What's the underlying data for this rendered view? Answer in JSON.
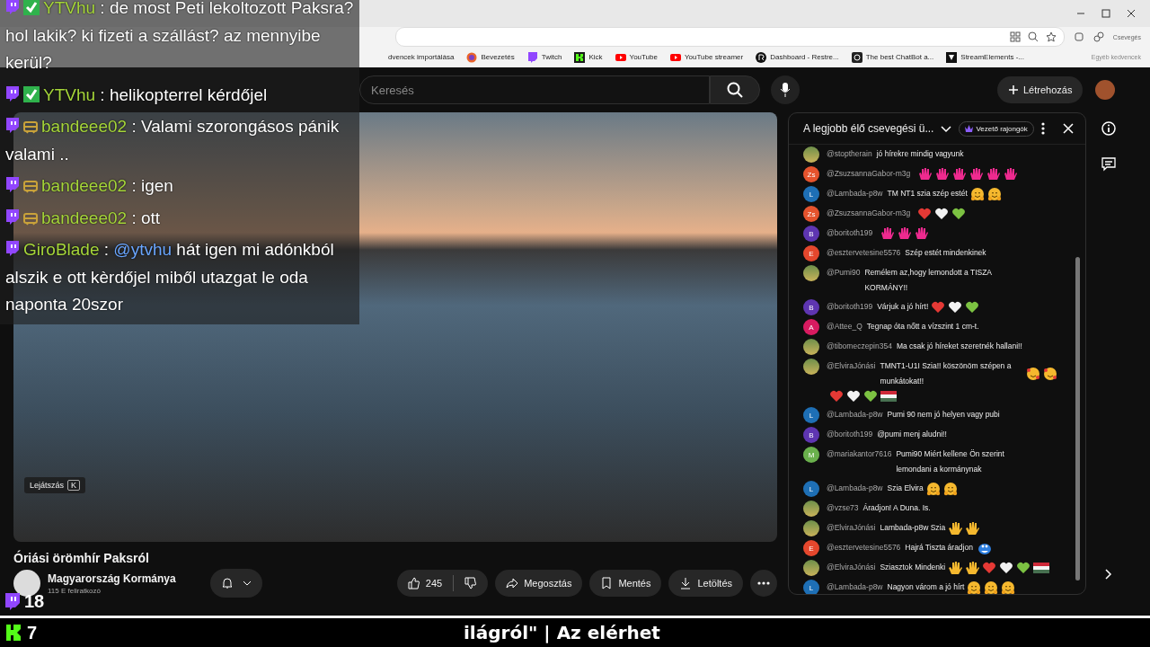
{
  "browser": {
    "bookmarks": [
      {
        "label": "dvencek importálása",
        "kind": "import"
      },
      {
        "label": "Bevezetés",
        "kind": "firefox"
      },
      {
        "label": "Twitch",
        "kind": "twitch"
      },
      {
        "label": "Kick",
        "kind": "kick"
      },
      {
        "label": "YouTube",
        "kind": "youtube"
      },
      {
        "label": "YouTube streamer",
        "kind": "youtube"
      },
      {
        "label": "Dashboard - Restre...",
        "kind": "restream"
      },
      {
        "label": "The best ChatBot a...",
        "kind": "chatbot"
      },
      {
        "label": "StreamElements -...",
        "kind": "streamelements"
      }
    ],
    "side_label": "Csevegés",
    "other_bookmarks": "Egyéb kedvencek"
  },
  "youtube": {
    "search": {
      "placeholder": "Keresés"
    },
    "create_label": "Létrehozás"
  },
  "video": {
    "tooltip": "Lejátszás",
    "shortcut": "K",
    "title": "Óriási örömhír Paksról",
    "channel": "Magyarország Kormánya",
    "subscribers": "115 E feliratkozó",
    "likes": "245",
    "actions": [
      {
        "label": "Megosztás",
        "kind": "share"
      },
      {
        "label": "Mentés",
        "kind": "save"
      },
      {
        "label": "Letöltés",
        "kind": "download"
      }
    ]
  },
  "chat": {
    "title": "A legjobb élő csevegési ü...",
    "filter": "Vezető rajongók",
    "messages": [
      {
        "kind": "photo",
        "author": "@stoptherain",
        "text": "jó hírekre mindig vagyunk"
      },
      {
        "kind": "letter",
        "letter": "Zs",
        "color": "#e5532d",
        "author": "@ZsuzsannaGabor-m3g",
        "emojis": [
          {
            "kind": "hand"
          },
          {
            "kind": "hand"
          },
          {
            "kind": "hand"
          },
          {
            "kind": "hand"
          },
          {
            "kind": "hand"
          },
          {
            "kind": "hand"
          }
        ]
      },
      {
        "kind": "letter",
        "letter": "L",
        "color": "#1e6fb5",
        "author": "@Lambada-p8w",
        "text": "TM NT1 szia szép estét",
        "emojis": [
          {
            "kind": "hug"
          },
          {
            "kind": "hug"
          }
        ]
      },
      {
        "kind": "letter",
        "letter": "Zs",
        "color": "#e5532d",
        "author": "@ZsuzsannaGabor-m3g",
        "emojis": [
          {
            "kind": "heart_red"
          },
          {
            "kind": "heart_white"
          },
          {
            "kind": "heart_green"
          }
        ]
      },
      {
        "kind": "letter",
        "letter": "B",
        "color": "#5e35b1",
        "author": "@boritoth199",
        "emojis": [
          {
            "kind": "hand"
          },
          {
            "kind": "hand"
          },
          {
            "kind": "hand"
          }
        ]
      },
      {
        "kind": "letter",
        "letter": "E",
        "color": "#e5472d",
        "author": "@esztervetesine5576",
        "text": "Szép estét mindenkinek"
      },
      {
        "kind": "photo",
        "author": "@Pumi90",
        "text": "Remélem az,hogy lemondott a TISZA KORMÁNY!!"
      },
      {
        "kind": "letter",
        "letter": "B",
        "color": "#5e35b1",
        "author": "@boritoth199",
        "text": "Várjuk a jó hírt!",
        "emojis": [
          {
            "kind": "heart_red"
          },
          {
            "kind": "heart_white"
          },
          {
            "kind": "heart_green"
          }
        ]
      },
      {
        "kind": "letter",
        "letter": "A",
        "color": "#d81b60",
        "author": "@Attee_Q",
        "text": "Tegnap óta nőtt a vízszint 1 cm-t."
      },
      {
        "kind": "photo",
        "author": "@tibomeczepin354",
        "text": "Ma csak jó híreket szeretnék hallani!!"
      },
      {
        "kind": "photo",
        "author": "@ElviraJónási",
        "text": "TMNT1-U1I Szia!! köszönöm szépen a munkátokat!!",
        "emojis": [
          {
            "kind": "love"
          },
          {
            "kind": "love"
          },
          {
            "kind": "heart_red"
          },
          {
            "kind": "heart_white"
          },
          {
            "kind": "heart_green"
          },
          {
            "kind": "flag_hu"
          }
        ]
      },
      {
        "kind": "letter",
        "letter": "L",
        "color": "#1e6fb5",
        "author": "@Lambada-p8w",
        "text": "Pumi 90 nem jó helyen vagy pubi"
      },
      {
        "kind": "letter",
        "letter": "B",
        "color": "#5e35b1",
        "author": "@boritoth199",
        "text": "@pumi menj aludni!!"
      },
      {
        "kind": "letter",
        "letter": "M",
        "color": "#6ab04c",
        "author": "@mariakantor7616",
        "text": "Pumi90 Miért kellene Ön szerint lemondani a kormánynak"
      },
      {
        "kind": "letter",
        "letter": "L",
        "color": "#1e6fb5",
        "author": "@Lambada-p8w",
        "text": "Szia Elvira",
        "emojis": [
          {
            "kind": "hug"
          },
          {
            "kind": "hug"
          }
        ]
      },
      {
        "kind": "photo",
        "author": "@vzse73",
        "text": "Áradjon! A Duna. Is."
      },
      {
        "kind": "photo",
        "author": "@ElviraJónási",
        "text": "Lambada-p8w Szia",
        "emojis": [
          {
            "kind": "wave"
          },
          {
            "kind": "wave"
          }
        ]
      },
      {
        "kind": "letter",
        "letter": "E",
        "color": "#e5472d",
        "author": "@esztervetesine5576",
        "text": "Hajrá Tiszta áradjon",
        "emojis": [
          {
            "kind": "splash"
          }
        ]
      },
      {
        "kind": "photo",
        "author": "@ElviraJónási",
        "text": "Sziasztok Mindenki",
        "emojis": [
          {
            "kind": "wave"
          },
          {
            "kind": "wave"
          },
          {
            "kind": "heart_red"
          },
          {
            "kind": "heart_white"
          },
          {
            "kind": "heart_green"
          },
          {
            "kind": "flag_hu"
          }
        ]
      },
      {
        "kind": "letter",
        "letter": "L",
        "color": "#1e6fb5",
        "author": "@Lambada-p8w",
        "text": "Nagyon várom a jó hírt",
        "emojis": [
          {
            "kind": "hug"
          },
          {
            "kind": "hug"
          },
          {
            "kind": "hug"
          }
        ]
      }
    ]
  },
  "overlay": {
    "messages": [
      {
        "kind": "verified",
        "author": "YTVhu",
        "separator": ":",
        "text": "de most Peti lekoltozott Paksra? hol lakik? ki fizeti a szállást? az mennyibe kerül?"
      },
      {
        "kind": "verified",
        "author": "YTVhu",
        "separator": ":",
        "text": "helikopterrel kérdőjel"
      },
      {
        "kind": "bot",
        "author": "bandeee02",
        "separator": ":",
        "text": "Valami szorongásos pánik valami .."
      },
      {
        "kind": "bot",
        "author": "bandeee02",
        "separator": ":",
        "text": "igen"
      },
      {
        "kind": "bot",
        "author": "bandeee02",
        "separator": ":",
        "text": "ott"
      },
      {
        "kind": "plain",
        "author": "GiroBlade",
        "separator": ":",
        "mention": "@ytvhu",
        "text": "hát igen mi adónkból alszik e ott kèrdőjel miből utazgat le oda naponta 20szor"
      }
    ],
    "twitch_viewers": "18",
    "kick_viewers": "7",
    "ticker": "ilágról\" | Az elérhet"
  }
}
